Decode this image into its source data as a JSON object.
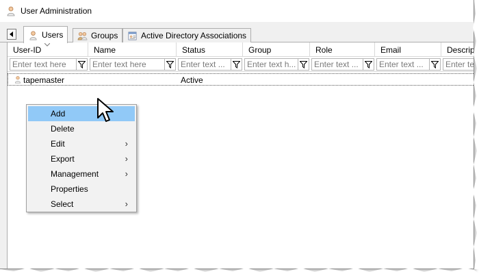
{
  "window": {
    "title": "User Administration",
    "title_icon": "user-icon"
  },
  "tabs": [
    {
      "label": "Users",
      "icon": "user-icon",
      "active": true
    },
    {
      "label": "Groups",
      "icon": "group-icon",
      "active": false
    },
    {
      "label": "Active Directory Associations",
      "icon": "directory-icon",
      "active": false
    }
  ],
  "table": {
    "columns": [
      {
        "label": "User-ID",
        "filter_placeholder": "Enter text here"
      },
      {
        "label": "Name",
        "filter_placeholder": "Enter text here"
      },
      {
        "label": "Status",
        "filter_placeholder": "Enter text ..."
      },
      {
        "label": "Group",
        "filter_placeholder": "Enter text h..."
      },
      {
        "label": "Role",
        "filter_placeholder": "Enter text ..."
      },
      {
        "label": "Email",
        "filter_placeholder": "Enter text ..."
      },
      {
        "label": "Descripti",
        "filter_placeholder": "Enter text"
      }
    ],
    "rows": [
      {
        "user_id": "tapemaster",
        "name": "",
        "status": "Active"
      }
    ]
  },
  "context_menu": {
    "items": [
      {
        "label": "Add",
        "submenu": false,
        "highlighted": true
      },
      {
        "label": "Delete",
        "submenu": false,
        "highlighted": false
      },
      {
        "label": "Edit",
        "submenu": true,
        "highlighted": false
      },
      {
        "label": "Export",
        "submenu": true,
        "highlighted": false
      },
      {
        "label": "Management",
        "submenu": true,
        "highlighted": false
      },
      {
        "label": "Properties",
        "submenu": false,
        "highlighted": false
      },
      {
        "label": "Select",
        "submenu": true,
        "highlighted": false
      }
    ],
    "submenu_glyph": "›"
  },
  "colors": {
    "highlight": "#91c9f7",
    "menu_bg": "#f2f2f2",
    "window_bg": "#f0f0f0"
  }
}
